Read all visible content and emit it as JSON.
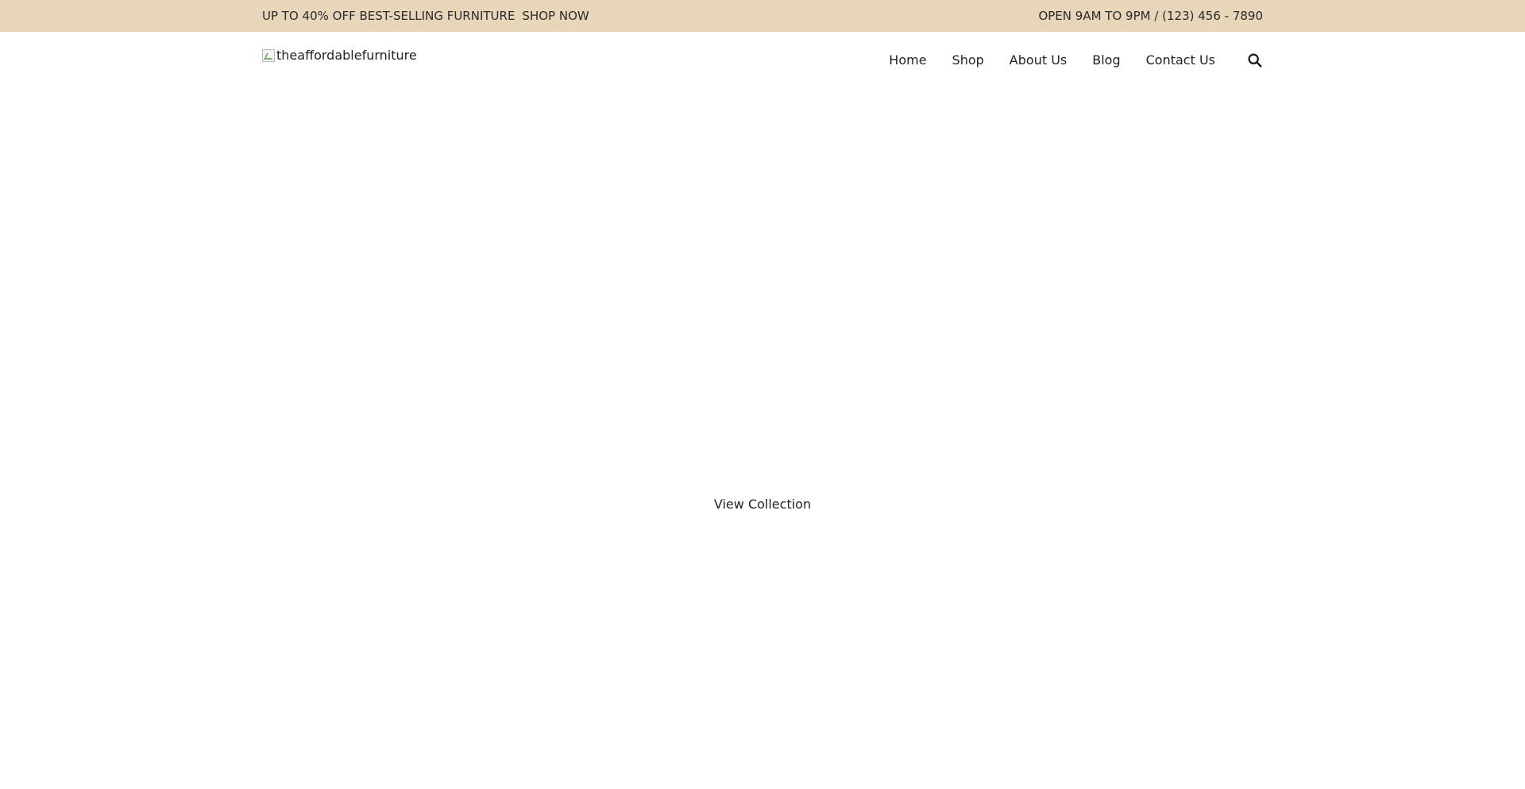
{
  "topbar": {
    "promo_text": "UP TO 40% OFF BEST-SELLING FURNITURE",
    "promo_link": "SHOP NOW",
    "hours_text": "OPEN 9AM TO 9PM / (123) 456 - 7890",
    "background_color": "#e8d6bb"
  },
  "header": {
    "logo_alt": "theaffordablefurniture",
    "nav": {
      "home": "Home",
      "shop": "Shop",
      "about": "About Us",
      "blog": "Blog",
      "contact": "Contact Us"
    },
    "search_icon": "search-icon"
  },
  "hero": {
    "cta_label": "View Collection"
  }
}
